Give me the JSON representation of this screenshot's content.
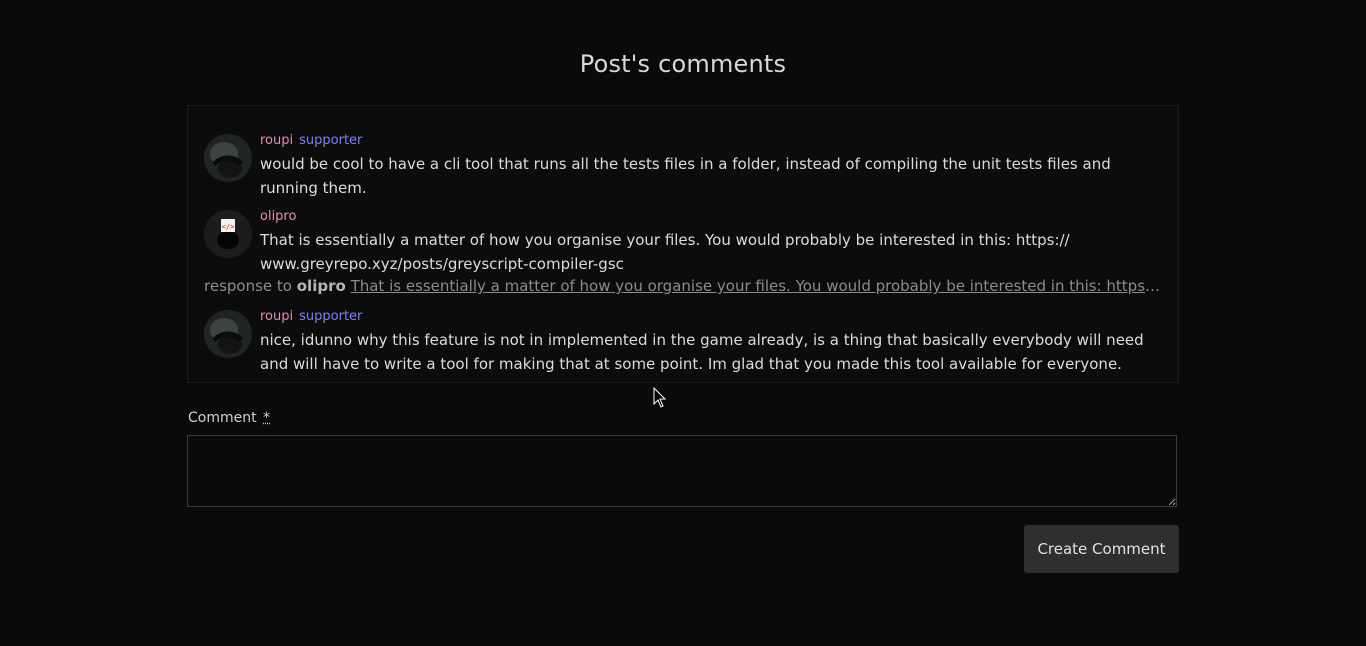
{
  "page": {
    "title": "Post's comments"
  },
  "comments": [
    {
      "author": "roupi",
      "badge": "supporter",
      "avatar_icon": "roupi-avatar",
      "body": "would be cool to have a cli tool that runs all the tests files in a folder, instead of compiling the unit tests files and running them."
    },
    {
      "author": "olipro",
      "badge": "",
      "avatar_icon": "code-tag-avatar",
      "avatar_text": "</>",
      "body": "That is essentially a matter of how you organise your files. You would probably be interested in this: https:// www.greyrepo.xyz/posts/greyscript-compiler-gsc"
    },
    {
      "reply_prefix": "response to",
      "reply_to": "olipro",
      "reply_quote": "That is essentially a matter of how you organise your files. You would probably be interested in this: https://www.greyrepo.xyz/posts/greyscript-compiler-gsc",
      "author": "roupi",
      "badge": "supporter",
      "avatar_icon": "roupi-avatar",
      "body": "nice, idunno why this feature is not in implemented in the game already, is a thing that basically everybody will need and will have to write a tool for making that at some point. Im glad that you made this tool available for everyone."
    }
  ],
  "form": {
    "label": "Comment",
    "required_marker": "*",
    "value": "",
    "submit_label": "Create Comment"
  },
  "colors": {
    "background": "#0a0a0b",
    "author": "#e090b4",
    "badge": "#7b83f0",
    "button": "#2f2f31"
  }
}
